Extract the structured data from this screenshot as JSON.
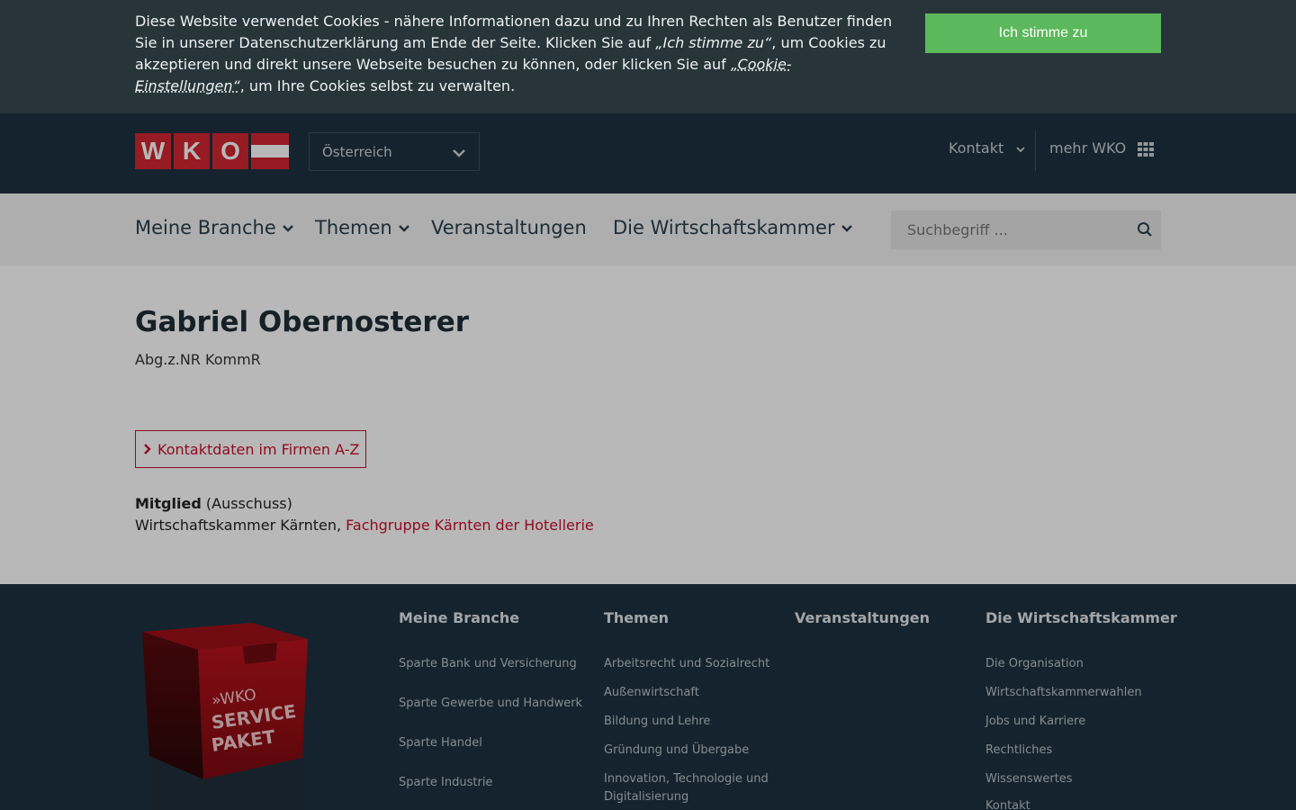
{
  "cookie": {
    "text_1": "Diese Website verwendet Cookies - nähere Informationen dazu und zu Ihren Rechten als Benutzer finden Sie in unserer Datenschutzerklärung am Ende der Seite. Klicken Sie auf ",
    "accept_quote": "„Ich stimme zu“",
    "text_2": ", um Cookies zu akzeptieren und direkt unsere Webseite besuchen zu können, oder klicken Sie auf ",
    "settings_link": "„Cookie-Einstellungen“",
    "text_3": ", um Ihre Cookies selbst zu verwalten.",
    "accept_button": "Ich stimme zu"
  },
  "header": {
    "logo_letters": [
      "W",
      "K",
      "O"
    ],
    "region": "Österreich",
    "kontakt": "Kontakt",
    "mehr": "mehr WKO"
  },
  "nav": {
    "items": [
      "Meine Branche",
      "Themen",
      "Veranstaltungen",
      "Die Wirtschaftskammer"
    ],
    "search_placeholder": "Suchbegriff ..."
  },
  "person": {
    "name": "Gabriel Obernosterer",
    "title": "Abg.z.NR KommR",
    "az_button": "Kontaktdaten im Firmen A-Z",
    "role": "Mitglied",
    "role_detail": "(Ausschuss)",
    "org": "Wirtschaftskammer Kärnten, ",
    "group_link": "Fachgruppe Kärnten der Hotellerie"
  },
  "footer": {
    "box_text": [
      "»WKO",
      "SERVICE",
      "PAKET"
    ],
    "columns": [
      {
        "title": "Meine Branche",
        "items": [
          "Sparte Bank und Versicherung",
          "Sparte Gewerbe und Handwerk",
          "Sparte Handel",
          "Sparte Industrie"
        ]
      },
      {
        "title": "Themen",
        "items": [
          "Arbeitsrecht und Sozialrecht",
          "Außenwirtschaft",
          "Bildung und Lehre",
          "Gründung und Übergabe",
          "Innovation, Technologie und Digitalisierung"
        ]
      },
      {
        "title": "Veranstaltungen",
        "items": []
      },
      {
        "title": "Die Wirtschaftskammer",
        "items": [
          "Die Organisation",
          "Wirtschaftskammerwahlen",
          "Jobs und Karriere",
          "Rechtliches",
          "Wissenswertes",
          "Kontakt"
        ]
      }
    ]
  },
  "colors": {
    "brand_red": "#d22630",
    "accept_green": "#5cb85c",
    "header_dark": "#1c3140"
  }
}
